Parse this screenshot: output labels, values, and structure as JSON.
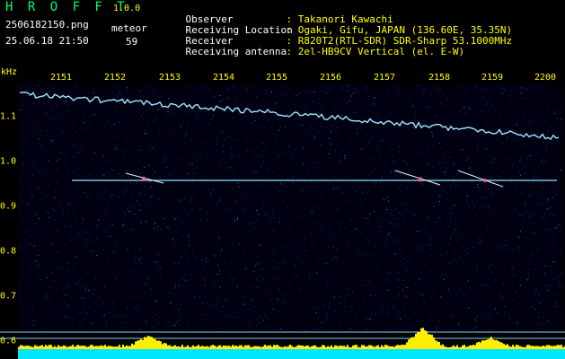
{
  "header": {
    "app_name": "H R O F F T",
    "version": "1.0.0",
    "filename": "2506182150.png",
    "datetime": "25.06.18 21:50",
    "meteor_label": "meteor",
    "meteor_count": "59"
  },
  "info": [
    {
      "label": "Observer",
      "value": ": Takanori Kawachi"
    },
    {
      "label": "Receiving Location",
      "value": ": Ogaki, Gifu, JAPAN (136.60E, 35.35N)"
    },
    {
      "label": "Receiver",
      "value": ": R820T2(RTL-SDR) SDR-Sharp 53.1000MHz"
    },
    {
      "label": "Receiving antenna",
      "value": ": 2el-HB9CV Vertical (el. E-W)"
    }
  ],
  "axis": {
    "unit": "kHz",
    "time_ticks": [
      "2151",
      "2152",
      "2153",
      "2154",
      "2155",
      "2156",
      "2157",
      "2158",
      "2159",
      "2200"
    ],
    "freq_ticks": [
      "1.1",
      "1.0",
      "0.9",
      "0.8",
      "0.7",
      "0.6"
    ]
  },
  "colors": {
    "header_green": "#00ff66",
    "label_white": "#ffffff",
    "tick_yellow": "#ffff00",
    "background": "#000000",
    "noise_blue": "#1a2a9a",
    "signal_cyan": "#66e0ff",
    "level_yellow": "#ffee00",
    "level_cyan": "#00eaff"
  }
}
